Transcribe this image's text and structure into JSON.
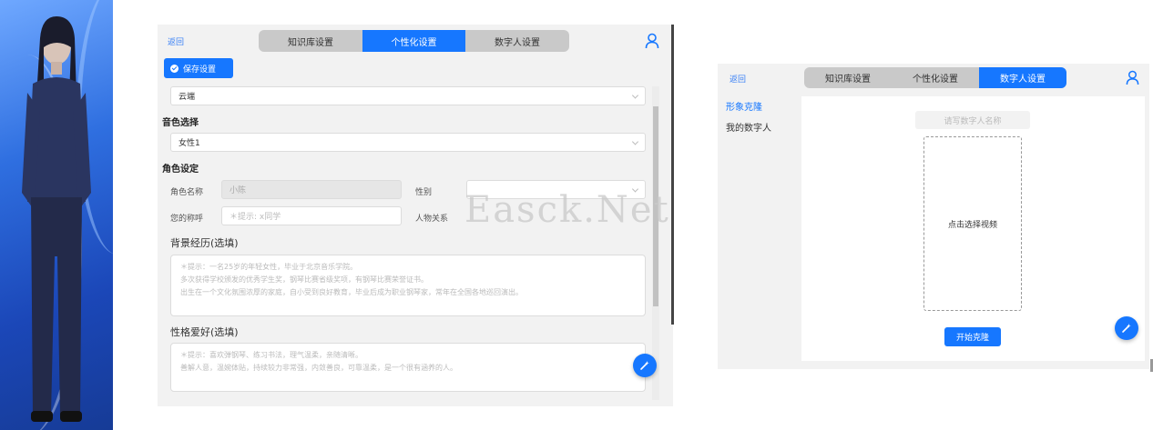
{
  "settings_panel": {
    "back_label": "返回",
    "tabs": [
      {
        "label": "知识库设置"
      },
      {
        "label": "个性化设置",
        "active": true
      },
      {
        "label": "数字人设置"
      }
    ],
    "save_label": "保存设置",
    "top_select_value": "云端",
    "voice_section_title": "音色选择",
    "voice_select_value": "女性1",
    "role_section_title": "角色设定",
    "role_name_label": "角色名称",
    "role_name_value": "小陈",
    "gender_label": "性别",
    "gender_value": "",
    "your_name_label": "您的称呼",
    "your_name_placeholder": "＊提示: x同学",
    "relation_label": "人物关系",
    "background_title": "背景经历(选填)",
    "background_placeholder_lines": [
      "＊提示：一名25岁的年轻女性，毕业于北京音乐学院。",
      "多次获得学校颁发的优秀学生奖，钢琴比赛省级奖项，有钢琴比赛荣誉证书。",
      "出生在一个文化氛围浓厚的家庭，自小受到良好教育，毕业后成为职业钢琴家，常年在全国各地巡回演出。"
    ],
    "hobby_title": "性格爱好(选填)",
    "hobby_placeholder_lines": [
      "＊提示：喜欢弹钢琴、练习书法，理气温柔，亲随清晰。",
      "善解人意，温婉体贴，持续较力非常强，内敛善良，可靠温柔，是一个很有涵养的人。"
    ]
  },
  "digital_panel": {
    "back_label": "返回",
    "tabs": [
      {
        "label": "知识库设置"
      },
      {
        "label": "个性化设置"
      },
      {
        "label": "数字人设置",
        "active": true
      }
    ],
    "sidebar": [
      {
        "label": "形象克隆",
        "active": true
      },
      {
        "label": "我的数字人"
      }
    ],
    "name_placeholder": "请写数字人名称",
    "upload_label": "点击选择视频",
    "clone_button": "开始克隆"
  },
  "watermark": "Easck.Net",
  "colors": {
    "accent": "#1677ff",
    "tab_bg": "#c9c9c9",
    "panel_bg": "#f2f2f2"
  }
}
